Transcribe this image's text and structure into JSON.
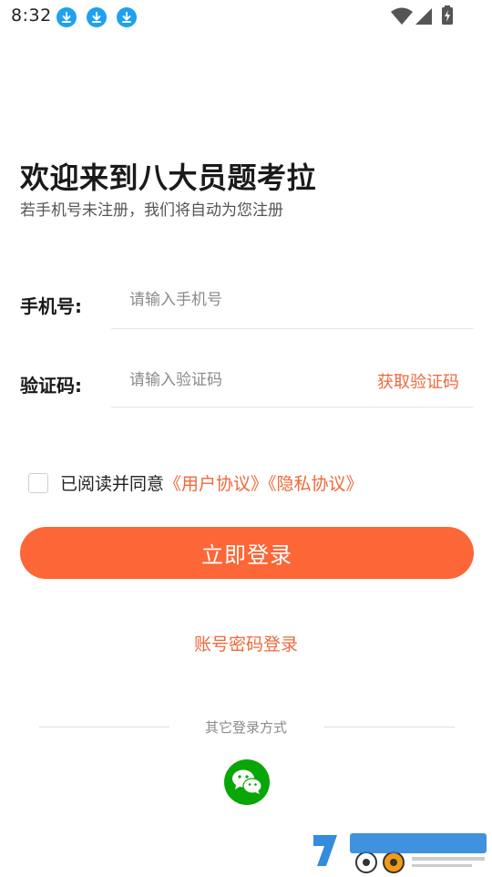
{
  "status_bar": {
    "time": "8:32",
    "icons": [
      "download-icon",
      "download-icon",
      "download-icon",
      "wifi-icon",
      "signal-icon",
      "battery-icon"
    ]
  },
  "header": {
    "title": "欢迎来到八大员题考拉",
    "subtitle": "若手机号未注册，我们将自动为您注册"
  },
  "form": {
    "phone_label": "手机号:",
    "phone_placeholder": "请输入手机号",
    "phone_value": "",
    "code_label": "验证码:",
    "code_placeholder": "请输入验证码",
    "code_value": "",
    "get_code_label": "获取验证码"
  },
  "agreement": {
    "checked": false,
    "text": "已阅读并同意",
    "user_agreement": "《用户协议》",
    "privacy_policy": "《隐私协议》"
  },
  "actions": {
    "login_label": "立即登录",
    "password_login_label": "账号密码登录"
  },
  "other_login": {
    "label": "其它登录方式",
    "methods": [
      "wechat-icon"
    ]
  },
  "colors": {
    "accent": "#fd6636",
    "link": "#f0683b",
    "wechat": "#09a608",
    "download_badge": "#1ea1f2"
  }
}
